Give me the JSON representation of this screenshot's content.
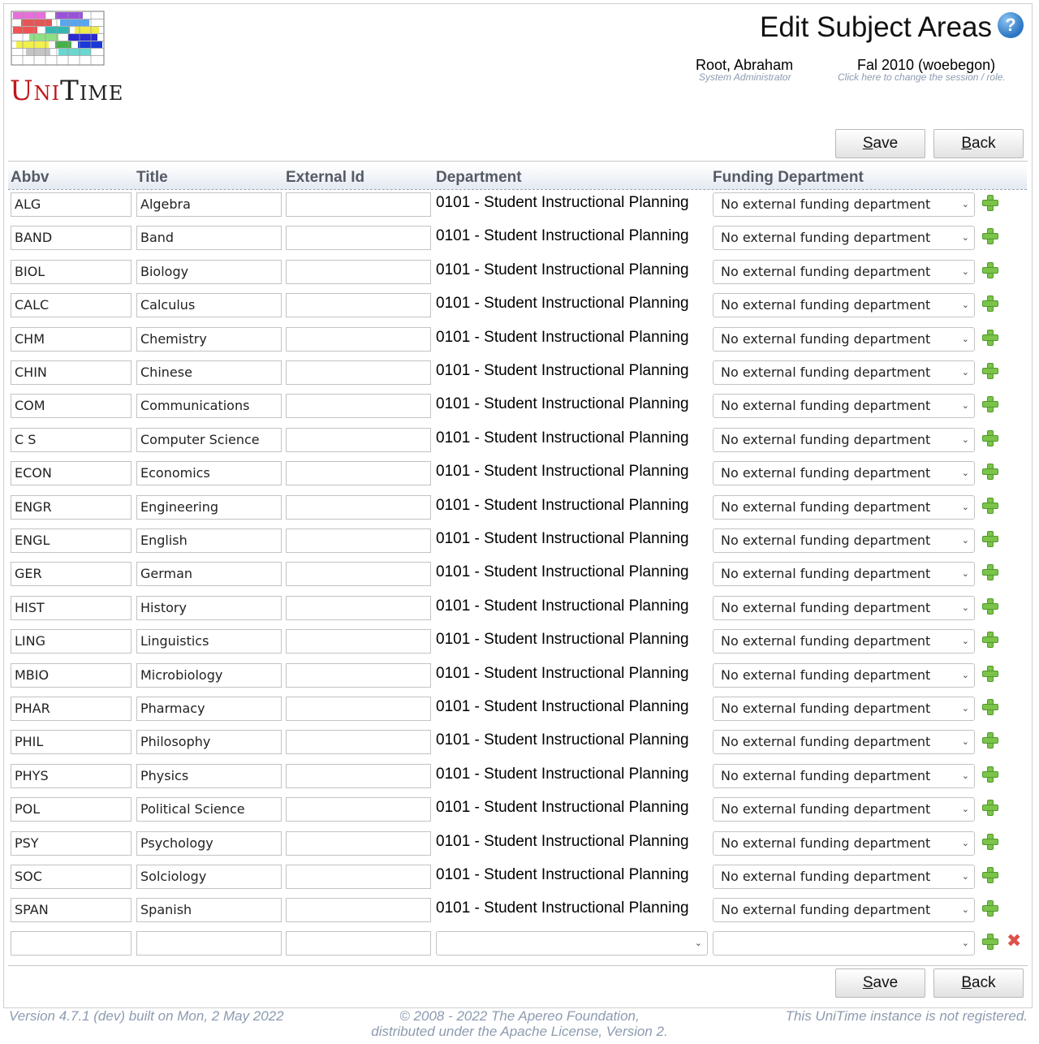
{
  "logo": {
    "text_u": "U",
    "text_ni": "NI",
    "text_t": "T",
    "text_ime": "IME"
  },
  "header": {
    "title": "Edit Subject Areas",
    "help": "?",
    "user_name": "Root, Abraham",
    "user_role": "System Administrator",
    "session_name": "Fal 2010 (woebegon)",
    "session_hint": "Click here to change the session / role."
  },
  "buttons": {
    "save_first": "S",
    "save_rest": "ave",
    "back_first": "B",
    "back_rest": "ack"
  },
  "table": {
    "columns": [
      "Abbv",
      "Title",
      "External Id",
      "Department",
      "Funding Department"
    ],
    "rows": [
      {
        "abbv": "ALG",
        "title": "Algebra",
        "external_id": "",
        "department": "0101 - Student Instructional Planning",
        "funding": "No external funding department"
      },
      {
        "abbv": "BAND",
        "title": "Band",
        "external_id": "",
        "department": "0101 - Student Instructional Planning",
        "funding": "No external funding department"
      },
      {
        "abbv": "BIOL",
        "title": "Biology",
        "external_id": "",
        "department": "0101 - Student Instructional Planning",
        "funding": "No external funding department"
      },
      {
        "abbv": "CALC",
        "title": "Calculus",
        "external_id": "",
        "department": "0101 - Student Instructional Planning",
        "funding": "No external funding department"
      },
      {
        "abbv": "CHM",
        "title": "Chemistry",
        "external_id": "",
        "department": "0101 - Student Instructional Planning",
        "funding": "No external funding department"
      },
      {
        "abbv": "CHIN",
        "title": "Chinese",
        "external_id": "",
        "department": "0101 - Student Instructional Planning",
        "funding": "No external funding department"
      },
      {
        "abbv": "COM",
        "title": "Communications",
        "external_id": "",
        "department": "0101 - Student Instructional Planning",
        "funding": "No external funding department"
      },
      {
        "abbv": "C S",
        "title": "Computer Science",
        "external_id": "",
        "department": "0101 - Student Instructional Planning",
        "funding": "No external funding department"
      },
      {
        "abbv": "ECON",
        "title": "Economics",
        "external_id": "",
        "department": "0101 - Student Instructional Planning",
        "funding": "No external funding department"
      },
      {
        "abbv": "ENGR",
        "title": "Engineering",
        "external_id": "",
        "department": "0101 - Student Instructional Planning",
        "funding": "No external funding department"
      },
      {
        "abbv": "ENGL",
        "title": "English",
        "external_id": "",
        "department": "0101 - Student Instructional Planning",
        "funding": "No external funding department"
      },
      {
        "abbv": "GER",
        "title": "German",
        "external_id": "",
        "department": "0101 - Student Instructional Planning",
        "funding": "No external funding department"
      },
      {
        "abbv": "HIST",
        "title": "History",
        "external_id": "",
        "department": "0101 - Student Instructional Planning",
        "funding": "No external funding department"
      },
      {
        "abbv": "LING",
        "title": "Linguistics",
        "external_id": "",
        "department": "0101 - Student Instructional Planning",
        "funding": "No external funding department"
      },
      {
        "abbv": "MBIO",
        "title": "Microbiology",
        "external_id": "",
        "department": "0101 - Student Instructional Planning",
        "funding": "No external funding department"
      },
      {
        "abbv": "PHAR",
        "title": "Pharmacy",
        "external_id": "",
        "department": "0101 - Student Instructional Planning",
        "funding": "No external funding department"
      },
      {
        "abbv": "PHIL",
        "title": "Philosophy",
        "external_id": "",
        "department": "0101 - Student Instructional Planning",
        "funding": "No external funding department"
      },
      {
        "abbv": "PHYS",
        "title": "Physics",
        "external_id": "",
        "department": "0101 - Student Instructional Planning",
        "funding": "No external funding department"
      },
      {
        "abbv": "POL",
        "title": "Political Science",
        "external_id": "",
        "department": "0101 - Student Instructional Planning",
        "funding": "No external funding department"
      },
      {
        "abbv": "PSY",
        "title": "Psychology",
        "external_id": "",
        "department": "0101 - Student Instructional Planning",
        "funding": "No external funding department"
      },
      {
        "abbv": "SOC",
        "title": "Solciology",
        "external_id": "",
        "department": "0101 - Student Instructional Planning",
        "funding": "No external funding department"
      },
      {
        "abbv": "SPAN",
        "title": "Spanish",
        "external_id": "",
        "department": "0101 - Student Instructional Planning",
        "funding": "No external funding department"
      }
    ]
  },
  "icons": {
    "add": "plus-icon",
    "delete": "delete-icon",
    "select": "chevron-down-icon"
  },
  "footer": {
    "version": "Version 4.7.1 (dev) built on Mon, 2 May 2022",
    "copyright_line1": "© 2008 - 2022 The Apereo Foundation,",
    "copyright_line2": "distributed under the Apache License, Version 2.",
    "registration": "This UniTime instance is not registered."
  },
  "colors": {
    "accent_blue": "#2a74c2",
    "add_green": "#7cc34a",
    "delete_red": "#e0504a",
    "footer_gray": "#8c9bb0"
  }
}
